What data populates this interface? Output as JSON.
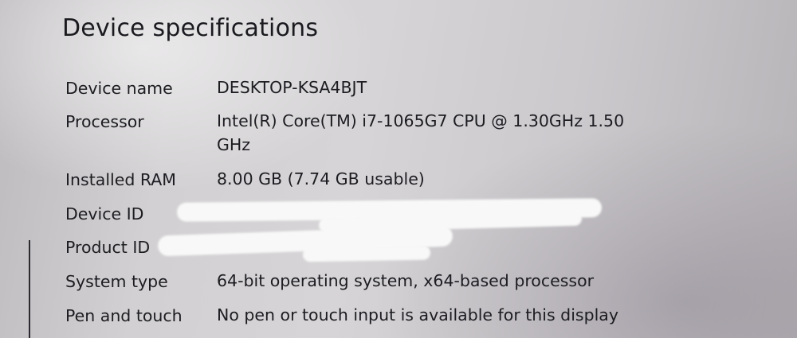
{
  "page": {
    "title": "Device specifications"
  },
  "specs": [
    {
      "label": "Device name",
      "value": "DESKTOP-KSA4BJT"
    },
    {
      "label": "Processor",
      "value": "Intel(R) Core(TM) i7-1065G7 CPU @ 1.30GHz   1.50 GHz"
    },
    {
      "label": "Installed RAM",
      "value": "8.00 GB (7.74 GB usable)"
    },
    {
      "label": "Device ID",
      "value": ""
    },
    {
      "label": "Product ID",
      "value": ""
    },
    {
      "label": "System type",
      "value": "64-bit operating system, x64-based processor"
    },
    {
      "label": "Pen and touch",
      "value": "No pen or touch input is available for this display"
    }
  ]
}
